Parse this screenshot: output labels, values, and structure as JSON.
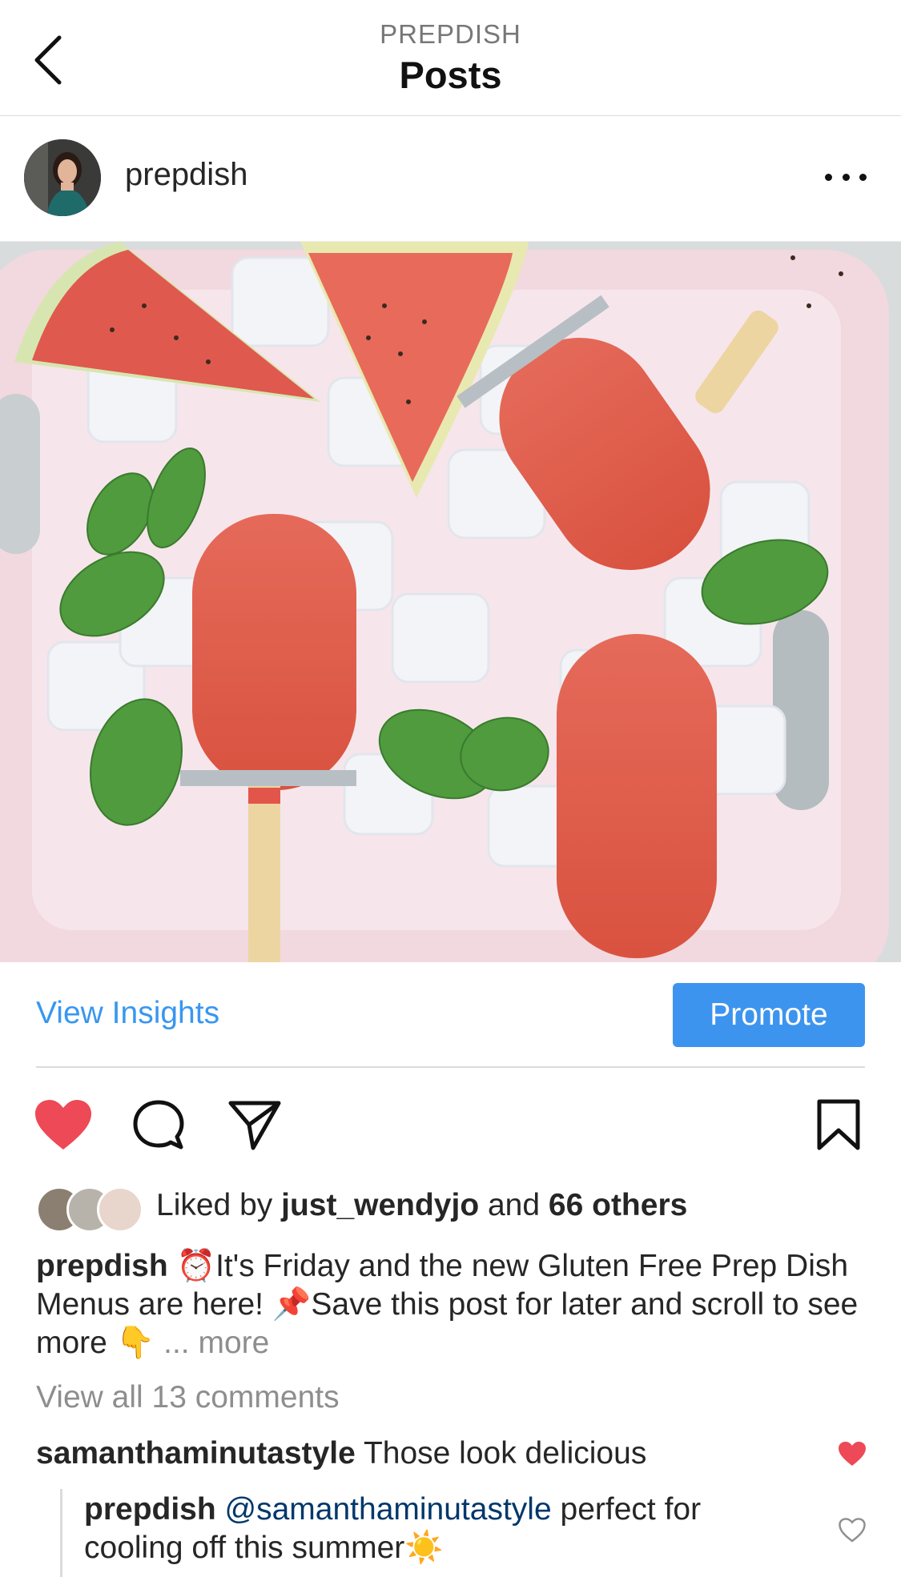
{
  "header": {
    "supertitle": "PREPDISH",
    "title": "Posts"
  },
  "post": {
    "username": "prepdish",
    "view_insights": "View Insights",
    "promote": "Promote",
    "likes": {
      "prefix": "Liked by ",
      "liker": "just_wendyjo",
      "middle": " and ",
      "others": "66 others"
    },
    "caption": {
      "username": "prepdish",
      "emoji1": "⏰",
      "text1": "It's Friday and the new Gluten Free Prep Dish Menus are here! ",
      "emoji2": "📌",
      "text2": "Save this post for later and scroll to see more ",
      "emoji3": "👇",
      "more": "... more"
    },
    "view_all_comments": "View all 13 comments",
    "comments": [
      {
        "username": "samanthaminutastyle",
        "text": "Those look delicious",
        "liked": true
      }
    ],
    "reply": {
      "username": "prepdish",
      "mention": "@samanthaminutastyle",
      "text": "perfect for cooling off this summer",
      "emoji": "☀️",
      "liked": false
    }
  },
  "colors": {
    "accent": "#3897f0",
    "promote_bg": "#3d94ee",
    "like_red": "#ed4956",
    "muted": "#8e8e8e"
  },
  "icons": [
    "back-icon",
    "more-options-icon",
    "heart-icon",
    "comment-icon",
    "share-icon",
    "bookmark-icon"
  ]
}
